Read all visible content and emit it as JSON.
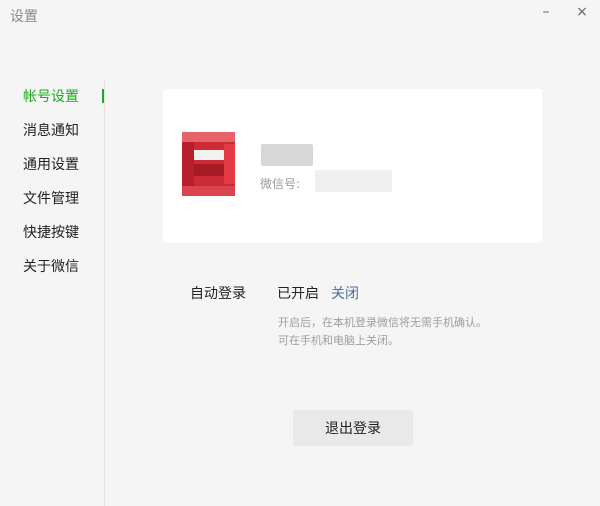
{
  "window": {
    "title": "设置",
    "minimize_label": "–",
    "close_label": "×"
  },
  "sidebar": {
    "items": [
      {
        "label": "帐号设置",
        "active": true
      },
      {
        "label": "消息通知"
      },
      {
        "label": "通用设置"
      },
      {
        "label": "文件管理"
      },
      {
        "label": "快捷按键"
      },
      {
        "label": "关于微信"
      }
    ]
  },
  "account": {
    "wechat_id_label": "微信号:"
  },
  "auto_login": {
    "label": "自动登录",
    "status": "已开启",
    "action_label": "关闭",
    "description_line1": "开启后，在本机登录微信将无需手机确认。",
    "description_line2": "可在手机和电脑上关闭。"
  },
  "logout_button_label": "退出登录",
  "colors": {
    "accent_green": "#1aad19",
    "link_blue": "#4a6fa5",
    "avatar_red": "#cc2a34"
  }
}
